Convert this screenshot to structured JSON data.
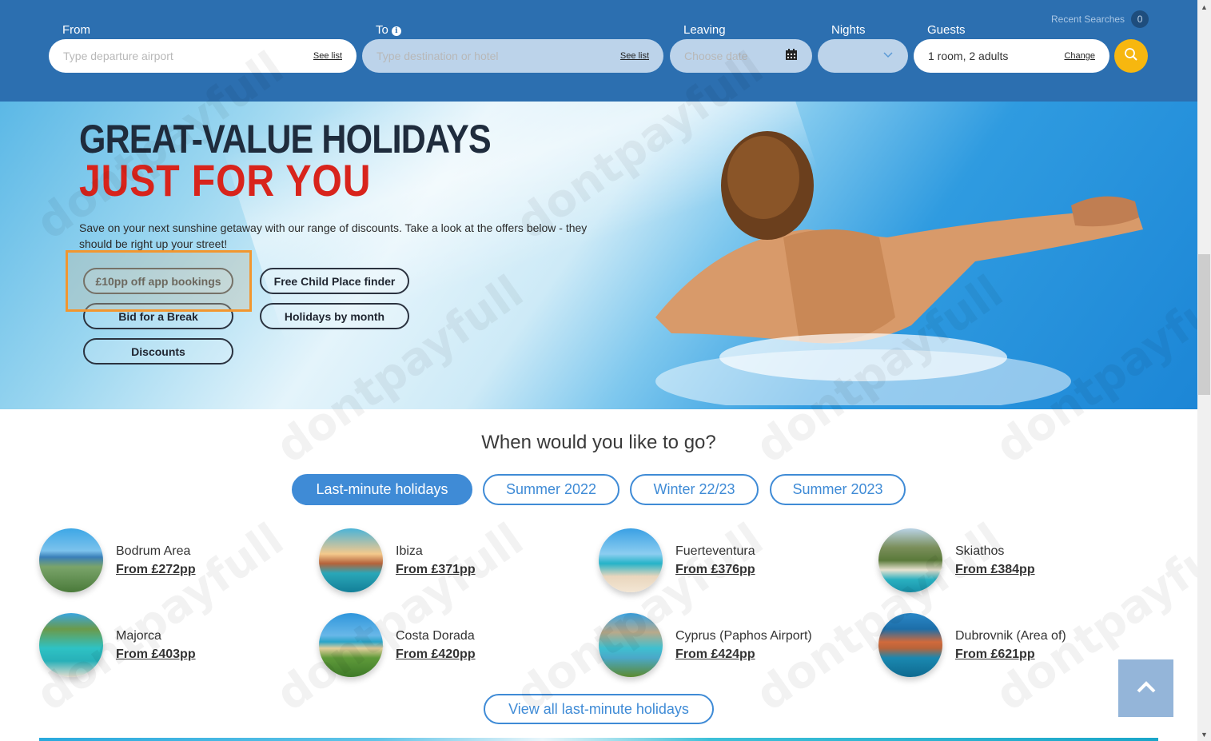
{
  "search": {
    "from": {
      "label": "From",
      "placeholder": "Type departure airport",
      "link": "See list"
    },
    "to": {
      "label": "To",
      "info_icon": "info-icon",
      "placeholder": "Type destination or hotel",
      "link": "See list"
    },
    "leaving": {
      "label": "Leaving",
      "placeholder": "Choose date",
      "icon": "calendar-icon"
    },
    "nights": {
      "label": "Nights",
      "value": "",
      "icon": "chevron-down-icon"
    },
    "guests": {
      "label": "Guests",
      "value": "1 room, 2 adults",
      "link": "Change"
    },
    "recent_searches": {
      "label": "Recent Searches",
      "count": "0"
    },
    "search_button_icon": "search-icon"
  },
  "hero": {
    "title_line1": "GREAT-VALUE HOLIDAYS",
    "title_line2": "JUST FOR YOU",
    "text": "Save on your next sunshine getaway with our range of discounts. Take a look at the offers below - they should be right up your street!",
    "buttons": [
      "£10pp off app bookings",
      "Free Child Place finder",
      "Bid for a Break",
      "Holidays by month",
      "Discounts"
    ]
  },
  "when": {
    "title": "When would you like to go?",
    "tabs": [
      {
        "label": "Last-minute holidays",
        "active": true
      },
      {
        "label": "Summer 2022",
        "active": false
      },
      {
        "label": "Winter 22/23",
        "active": false
      },
      {
        "label": "Summer 2023",
        "active": false
      }
    ],
    "destinations": [
      {
        "name": "Bodrum Area",
        "price": "From £272pp"
      },
      {
        "name": "Ibiza",
        "price": "From £371pp"
      },
      {
        "name": "Fuerteventura",
        "price": "From £376pp"
      },
      {
        "name": "Skiathos",
        "price": "From £384pp"
      },
      {
        "name": "Majorca",
        "price": "From £403pp"
      },
      {
        "name": "Costa Dorada",
        "price": "From £420pp"
      },
      {
        "name": "Cyprus (Paphos Airport)",
        "price": "From £424pp"
      },
      {
        "name": "Dubrovnik (Area of)",
        "price": "From £621pp"
      }
    ],
    "view_all": "View all last-minute holidays"
  },
  "colors": {
    "header_blue": "#2c6fb0",
    "accent_blue": "#3f8bd6",
    "search_yellow": "#f7b70f",
    "title_red": "#d8241c",
    "title_dark": "#1f2c3d",
    "highlight_orange": "#f2962f"
  }
}
